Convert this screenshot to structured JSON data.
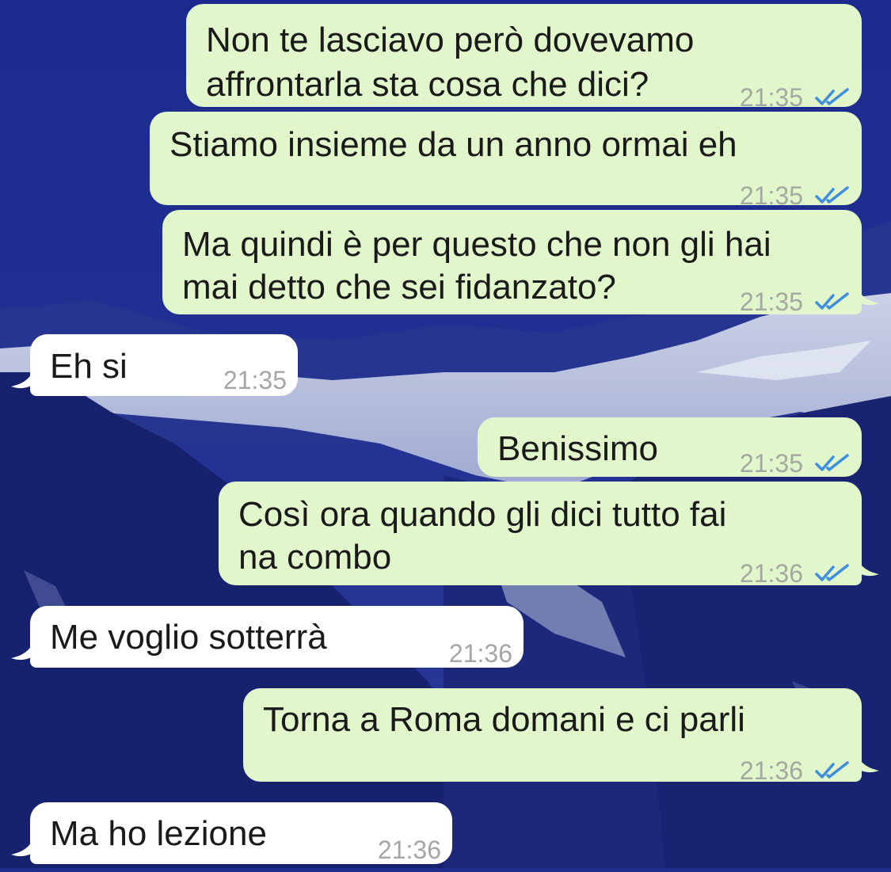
{
  "colors": {
    "outgoing_bubble": "#e1f7cb",
    "incoming_bubble": "#ffffff",
    "read_ticks": "#3f8ee0",
    "timestamp": "#a3a9a0",
    "wallpaper_sky": "#1f2c8c"
  },
  "icons": {
    "read_receipt": "double-check-icon"
  },
  "messages": [
    {
      "direction": "outgoing",
      "lines": [
        "Non te lasciavo però dovevamo",
        "affrontarla sta cosa che dici?"
      ],
      "time": "21:35",
      "status": "read"
    },
    {
      "direction": "outgoing",
      "lines": [
        "Stiamo insieme da un anno ormai eh"
      ],
      "time": "21:35",
      "status": "read"
    },
    {
      "direction": "outgoing",
      "lines": [
        "Ma quindi è per questo che non gli hai",
        "mai detto che sei fidanzato?"
      ],
      "time": "21:35",
      "status": "read"
    },
    {
      "direction": "incoming",
      "lines": [
        "Eh si"
      ],
      "time": "21:35"
    },
    {
      "direction": "outgoing",
      "lines": [
        "Benissimo"
      ],
      "time": "21:35",
      "status": "read"
    },
    {
      "direction": "outgoing",
      "lines": [
        "Così ora quando gli dici tutto fai",
        "na combo"
      ],
      "time": "21:36",
      "status": "read"
    },
    {
      "direction": "incoming",
      "lines": [
        "Me voglio sotterrà"
      ],
      "time": "21:36"
    },
    {
      "direction": "outgoing",
      "lines": [
        "Torna a Roma domani e ci parli"
      ],
      "time": "21:36",
      "status": "read"
    },
    {
      "direction": "incoming",
      "lines": [
        "Ma ho lezione"
      ],
      "time": "21:36"
    }
  ]
}
